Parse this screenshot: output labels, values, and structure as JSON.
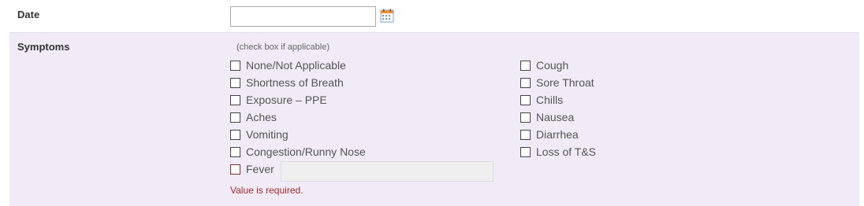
{
  "date": {
    "label": "Date",
    "value": "",
    "icon": "calendar-icon"
  },
  "symptoms": {
    "label": "Symptoms",
    "hint": "(check box if applicable)",
    "left_column": [
      "None/Not Applicable",
      "Shortness of Breath",
      "Exposure – PPE",
      "Aches",
      "Vomiting",
      "Congestion/Runny Nose",
      "Fever"
    ],
    "right_column": [
      "Cough",
      "Sore Throat",
      "Chills",
      "Nausea",
      "Diarrhea",
      "Loss of T&S"
    ],
    "fever_detail_value": "",
    "error_message": "Value is required."
  },
  "colors": {
    "section_background": "#f0ebf6",
    "error": "#a52a2a"
  }
}
